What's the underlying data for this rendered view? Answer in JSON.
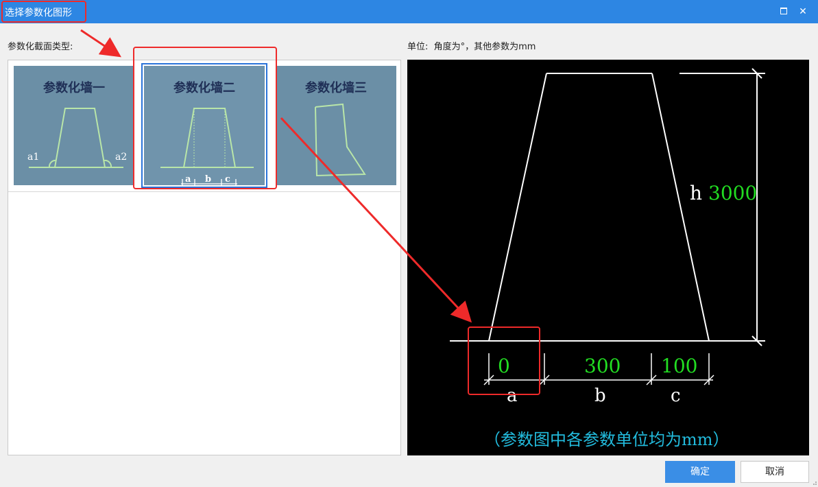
{
  "window": {
    "title": "选择参数化图形",
    "maximize_icon": "maximize-icon",
    "close_icon": "close-icon",
    "close_glyph": "✕"
  },
  "left": {
    "type_label": "参数化截面类型:",
    "thumbnails": [
      {
        "title": "参数化墙一",
        "labels": [
          "a1",
          "a2"
        ],
        "selected": false
      },
      {
        "title": "参数化墙二",
        "labels": [
          "a",
          "b",
          "c"
        ],
        "selected": true
      },
      {
        "title": "参数化墙三",
        "labels": [],
        "selected": false
      }
    ]
  },
  "right": {
    "unit_label": "单位:  角度为°，其他参数为mm",
    "params": {
      "h": {
        "name": "h",
        "value": "3000"
      },
      "a": {
        "name": "a",
        "value": "0"
      },
      "b": {
        "name": "b",
        "value": "300"
      },
      "c": {
        "name": "c",
        "value": "100"
      }
    },
    "note": "（参数图中各参数单位均为mm）"
  },
  "buttons": {
    "ok": "确定",
    "cancel": "取消"
  },
  "colors": {
    "titlebar": "#2d86e3",
    "value_green": "#22dd22",
    "note_cyan": "#22bbdd",
    "annotation_red": "#ee2a2a",
    "ok_blue": "#3a8ee6"
  }
}
